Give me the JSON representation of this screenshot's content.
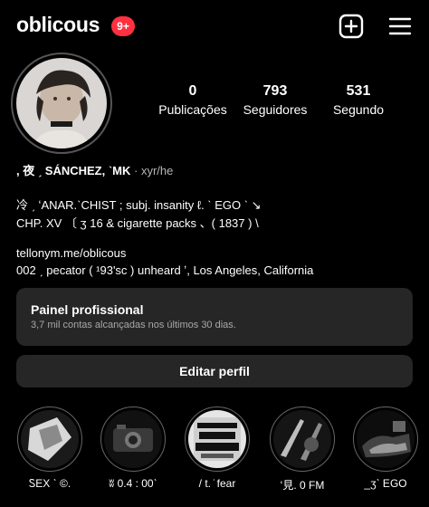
{
  "header": {
    "username": "oblicous",
    "notif_badge": "9+",
    "new_post_icon": "plus-square-icon",
    "menu_icon": "hamburger-menu-icon"
  },
  "stats": [
    {
      "value": "0",
      "label": "Publicações"
    },
    {
      "value": "793",
      "label": "Seguidores"
    },
    {
      "value": "531",
      "label": "Segundo"
    }
  ],
  "bio": {
    "name_line": ", 夜 ˏ SÁNCHEZ, ˋMK",
    "pronouns": "· xyr/he",
    "line1": "冷 ˏ ʻANAR.ˋCHIST ; subj. insanity ℓ. ˋ EGO ˋ ↘",
    "line2": "CHP. XV 〔 ʒ 16 & cigarette packs 、( 1837 ) \\",
    "link": "tellonym.me/oblicous",
    "line3_prefix": "002 ˏ pecator ( ¹93'sc ) unheard ʼ,",
    "location": "Los Angeles, California"
  },
  "professional": {
    "title": "Painel profissional",
    "subtitle": "3,7 mil contas alcançadas nos últimos 30 dias."
  },
  "edit_profile": "Editar perfil",
  "highlights": [
    {
      "label": "ᏚEX ˋ ©."
    },
    {
      "label": "ʬ 0.4 : 00ˋ"
    },
    {
      "label": "/ t. ̇ fear"
    },
    {
      "label": "ʻ見. 0 FM"
    },
    {
      "label": "_ʒˋ EGO"
    }
  ],
  "colors": {
    "background": "#000000",
    "card": "#262626",
    "badge": "#ff3040",
    "muted_text": "#a8a8a8"
  }
}
